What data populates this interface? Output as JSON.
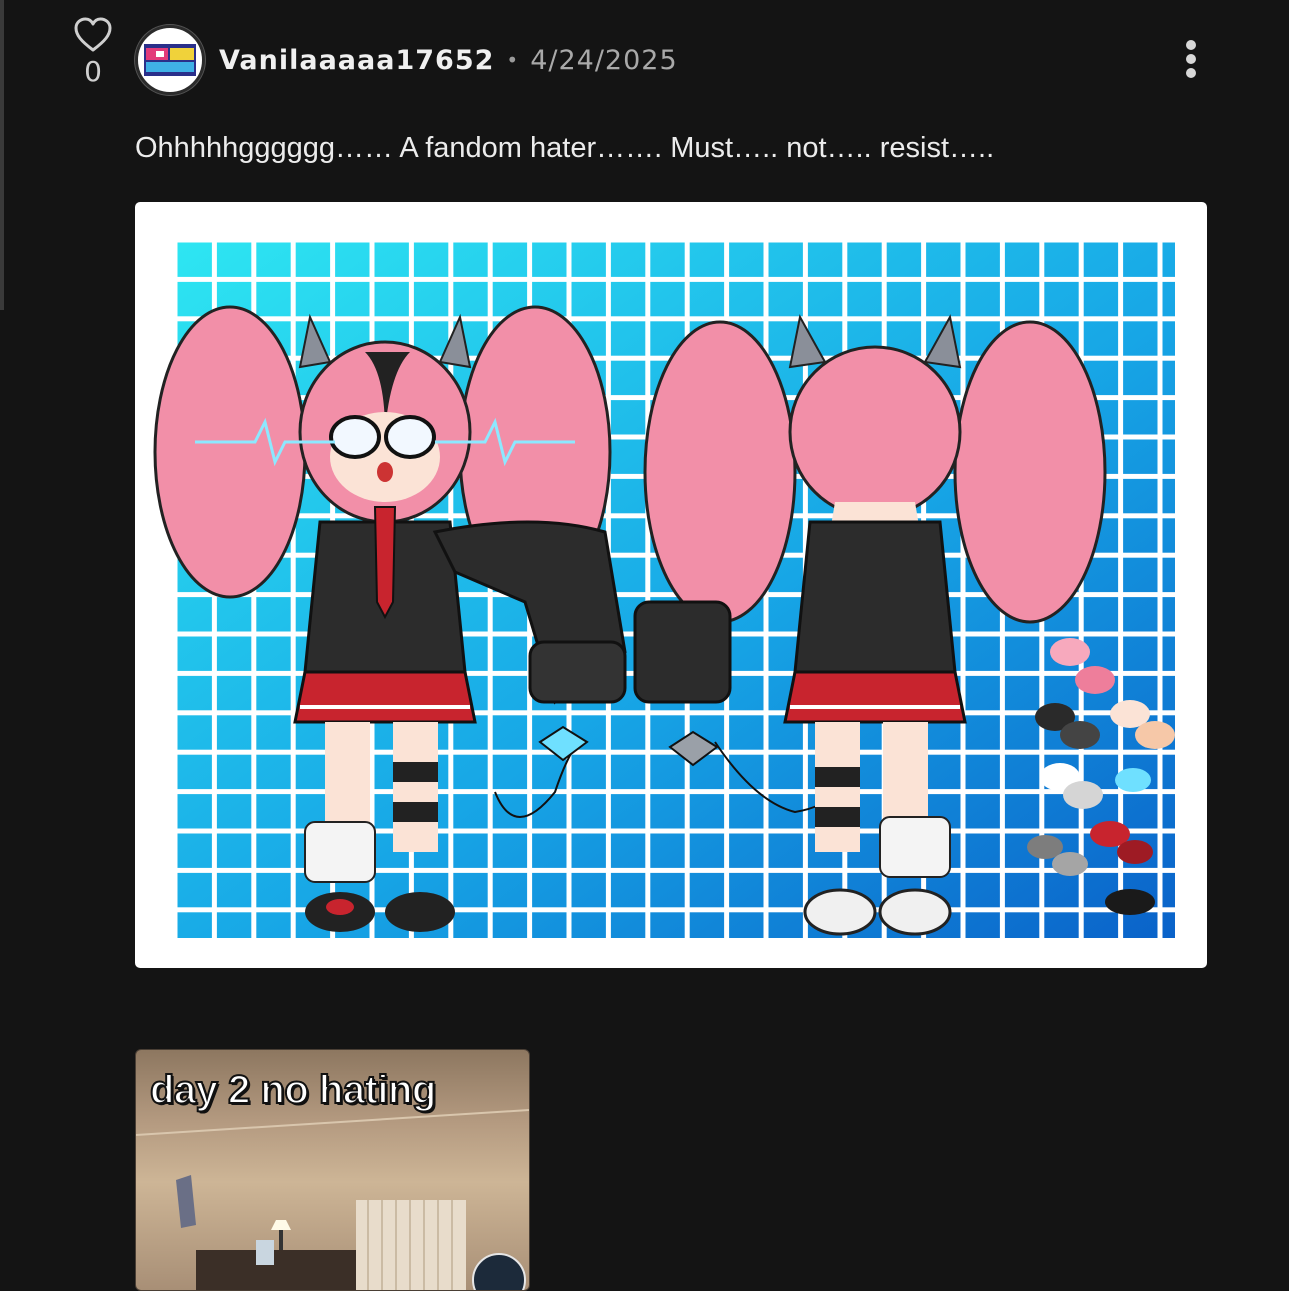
{
  "post": {
    "vote_count": "0",
    "username": "Vanilaaaaa17652",
    "separator": "•",
    "date": "4/24/2025",
    "text": "Ohhhhhgggggg…… A fandom hater……. Must….. not….. resist…..",
    "attachment_image": {
      "description": "character reference sheet, front and back views of a pink twin-tailed character in black sweater and red skirt on a cyan-blue grid",
      "colors": {
        "grid_top_left": "#2ee6f2",
        "grid_bottom_right": "#0a62c9",
        "hair": "#f28fa8",
        "sweater": "#2c2c2c",
        "skirt": "#c8242e"
      }
    },
    "video_thumbnail": {
      "caption": "day 2 no hating"
    }
  },
  "icons": {
    "like": "heart-outline-icon",
    "more": "vertical-ellipsis-icon"
  }
}
